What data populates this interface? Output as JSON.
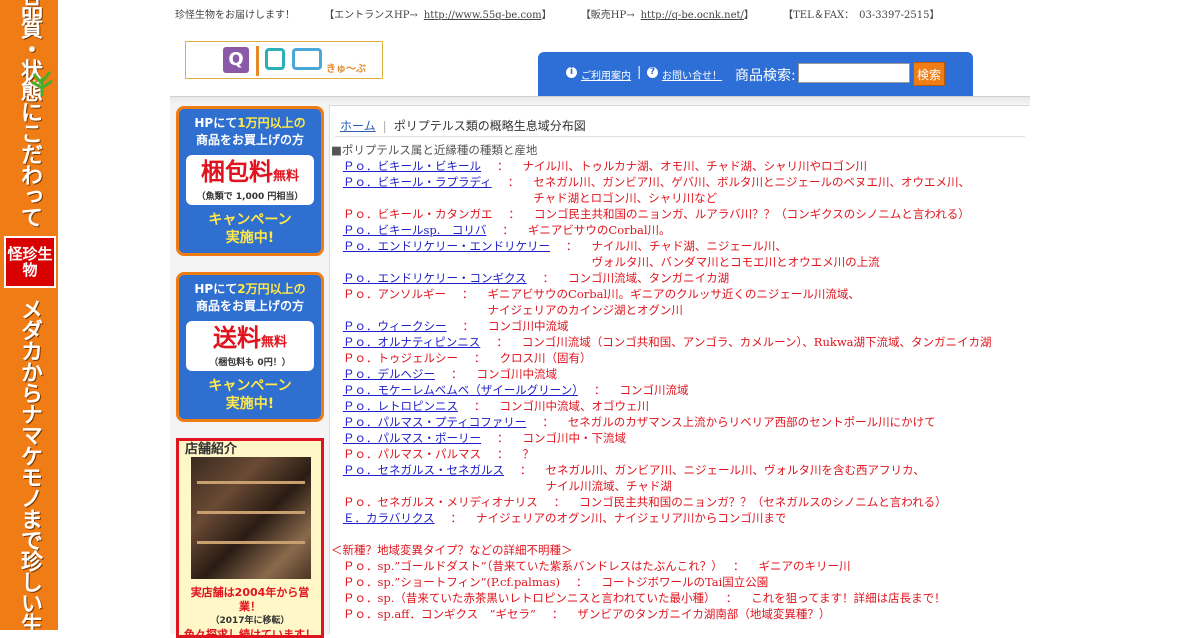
{
  "left_banner": {
    "top_text": "品質・状態にこだわってます!!",
    "seal_text": "怪珍生物",
    "bottom_text": "メダカからナマケモノまで珍しい生物たちが入荷します!!"
  },
  "topbar": {
    "tagline": "珍怪生物をお届けします！",
    "entrance_label": "【エントランスHP→",
    "entrance_url": "http://www.55q-be.com",
    "entrance_close": "】",
    "shop_label": "【販売HP→",
    "shop_url": "http://q-be.ocnk.net/",
    "shop_close": "】",
    "tel": "【TEL＆FAX：　03-3397-2515】"
  },
  "logo": {
    "letter_q": "Q",
    "kana": "きゅ～ぶ"
  },
  "searchbar": {
    "guide_link": "ご利用案内",
    "contact_link": "お問い合せ！",
    "search_label": "商品検索:",
    "search_value": "",
    "search_button": "検索"
  },
  "sidebar": {
    "promo1": {
      "line1_a": "HPにて",
      "line1_hl": "1万円以上の",
      "line2": "商品をお買上げの方",
      "big": "梱包料",
      "big_small": "無料",
      "note": "（魚類で 1,000 円相当）",
      "camp1": "キャンペーン",
      "camp2": "実施中!"
    },
    "promo2": {
      "line1_a": "HPにて",
      "line1_hl": "2万円以上の",
      "line2": "商品をお買上げの方",
      "big": "送料",
      "big_small": "無料",
      "note": "（梱包料も 0円！）",
      "camp1": "キャンペーン",
      "camp2": "実施中!"
    },
    "shop": {
      "title": "店舗紹介",
      "caption1": "実店舗は2004年から営業！",
      "caption2": "（2017年に移転）",
      "caption3": "色々探求し続けています！"
    }
  },
  "breadcrumb": {
    "home": "ホーム",
    "separator": "|",
    "current": "ポリプテルス類の概略生息域分布図"
  },
  "content": {
    "heading": "■ポリプテルス属と近縁種の種類と産地",
    "species": [
      {
        "name": "Ｐｏ．ビキール・ビキール",
        "link": true,
        "sep": "：",
        "habitat": "ナイル川、トゥルカナ湖、オモ川、チャド湖、シャリ川やロゴン川",
        "cont": ""
      },
      {
        "name": "Ｐｏ．ビキール・ラプラディ",
        "link": true,
        "sep": "：",
        "habitat": "セネガル川、ガンビア川、ゲバ川、ボルタ川とニジェールのベヌエ川、オウエメ川、",
        "cont": "チャド湖とロゴン川、シャリ川など"
      },
      {
        "name": "Ｐｏ．ビキール・カタンガエ",
        "link": false,
        "sep": "：",
        "habitat": "コンゴ民主共和国のニョンガ、ルアラバ川？？（コンギクスのシノニムと言われる）",
        "cont": ""
      },
      {
        "name": "Ｐｏ．ビキールsp.　コリバ",
        "link": true,
        "sep": "：",
        "habitat": "ギニアビサウのCorbal川。",
        "cont": ""
      },
      {
        "name": "Ｐｏ．エンドリケリー・エンドリケリー",
        "link": true,
        "sep": "：",
        "habitat": "ナイル川、チャド湖、ニジェール川、",
        "cont": "ヴォルタ川、バンダマ川とコモエ川とオウエメ川の上流"
      },
      {
        "name": "Ｐｏ．エンドリケリー・コンギクス",
        "link": true,
        "sep": "：",
        "habitat": "コンゴ川流域、タンガニイカ湖",
        "cont": ""
      },
      {
        "name": "Ｐｏ．アンソルギー",
        "link": false,
        "sep": "：",
        "habitat": "ギニアビサウのCorbal川。ギニアのクルッサ近くのニジェール川流域、",
        "cont": "ナイジェリアのカインジ湖とオグン川"
      },
      {
        "name": "Ｐｏ．ウィークシー",
        "link": true,
        "sep": "：",
        "habitat": "コンゴ川中流域",
        "cont": ""
      },
      {
        "name": "Ｐｏ．オルナティピンニス",
        "link": true,
        "sep": "：",
        "habitat": "コンゴ川流域（コンゴ共和国、アンゴラ、カメルーン）、Rukwa湖下流域、タンガニイカ湖",
        "cont": ""
      },
      {
        "name": "Ｐｏ．トゥジェルシー",
        "link": false,
        "sep": "：",
        "habitat": "クロス川（固有）",
        "cont": ""
      },
      {
        "name": "Ｐｏ．デルヘジー",
        "link": true,
        "sep": "：",
        "habitat": "コンゴ川中流域",
        "cont": ""
      },
      {
        "name": "Ｐｏ．モケーレムベムベ（ザイールグリーン）",
        "link": true,
        "sep": "：",
        "habitat": "コンゴ川流域",
        "cont": ""
      },
      {
        "name": "Ｐｏ．レトロピンニス",
        "link": true,
        "sep": "：",
        "habitat": "コンゴ川中流域、オゴウェ川",
        "cont": ""
      },
      {
        "name": "Ｐｏ．パルマス・プティコファリー",
        "link": true,
        "sep": "：",
        "habitat": "セネガルのカザマンス上流からリベリア西部のセントポール川にかけて",
        "cont": ""
      },
      {
        "name": "Ｐｏ．パルマス・ポーリー",
        "link": true,
        "sep": "：",
        "habitat": "コンゴ川中・下流域",
        "cont": ""
      },
      {
        "name": "Ｐｏ．パルマス・パルマス",
        "link": false,
        "sep": "：",
        "habitat": "？",
        "cont": ""
      },
      {
        "name": "Ｐｏ．セネガルス・セネガルス",
        "link": true,
        "sep": "：",
        "habitat": "セネガル川、ガンビア川、ニジェール川、ヴォルタ川を含む西アフリカ、",
        "cont": "ナイル川流域、チャド湖"
      },
      {
        "name": "Ｐｏ．セネガルス・メリディオナリス",
        "link": false,
        "sep": "：",
        "habitat": "コンゴ民主共和国のニョンガ？？（セネガルスのシノニムと言われる）",
        "cont": ""
      },
      {
        "name": "Ｅ．カラバリクス",
        "link": true,
        "sep": "：",
        "habitat": "ナイジェリアのオグン川、ナイジェリア川からコンゴ川まで",
        "cont": ""
      }
    ],
    "unknown_heading": "＜新種？地域変異タイプ？などの詳細不明種＞",
    "unknown": [
      {
        "name": "Ｐｏ．sp.”ゴールドダスト”（昔来ていた紫系バンドレスはたぶんこれ？）",
        "sep": "：",
        "habitat": "ギニアのキリー川"
      },
      {
        "name": "Ｐｏ．sp.”ショートフィン”(P.cf.palmas)",
        "sep": "：",
        "habitat": "コートジボワールのTai国立公園"
      },
      {
        "name": "Ｐｏ．sp.（昔来ていた赤茶黒いレトロピンニスと言われていた最小種）",
        "sep": "：",
        "habitat": "これを狙ってます！詳細は店長まで！"
      },
      {
        "name": "Ｐｏ．sp.aff．コンギクス　”ギセラ”",
        "sep": "：",
        "habitat": "ザンビアのタンガニイカ湖南部（地域変異種？）"
      }
    ]
  },
  "colors": {
    "accent_orange": "#f07c16",
    "nav_blue": "#2d6fd6",
    "text_red": "#e0141e",
    "link_blue": "#2020c8"
  }
}
